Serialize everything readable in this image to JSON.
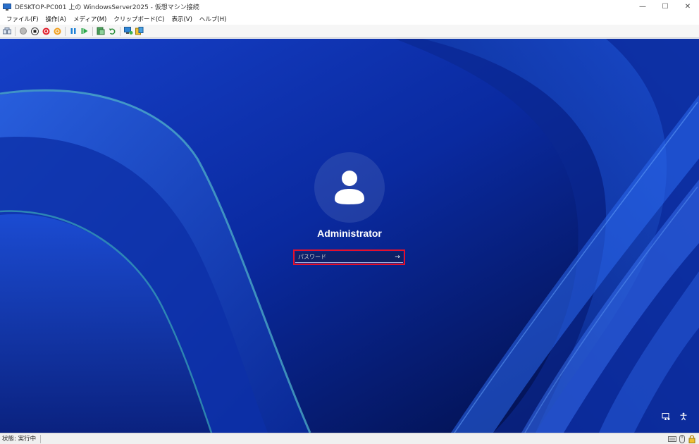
{
  "window": {
    "title": "DESKTOP-PC001 上の WindowsServer2025 - 仮想マシン接続",
    "controls": {
      "minimize": "—",
      "maximize": "☐",
      "close": "✕"
    }
  },
  "menu": {
    "items": [
      {
        "label": "ファイル(F)"
      },
      {
        "label": "操作(A)"
      },
      {
        "label": "メディア(M)"
      },
      {
        "label": "クリップボード(C)"
      },
      {
        "label": "表示(V)"
      },
      {
        "label": "ヘルプ(H)"
      }
    ]
  },
  "toolbar": {
    "buttons": [
      "ctrl-alt-del-icon",
      "start-icon",
      "turn-off-icon",
      "shut-down-icon",
      "save-icon",
      "pause-icon",
      "resume-icon",
      "checkpoint-icon",
      "revert-icon",
      "enhanced-session-icon",
      "share-icon"
    ]
  },
  "login": {
    "username": "Administrator",
    "password_placeholder": "パスワード",
    "submit_arrow": "→"
  },
  "status": {
    "text": "状態: 実行中"
  },
  "colors": {
    "highlight": "#e5102a",
    "vm_background": "#0a2aa8"
  }
}
